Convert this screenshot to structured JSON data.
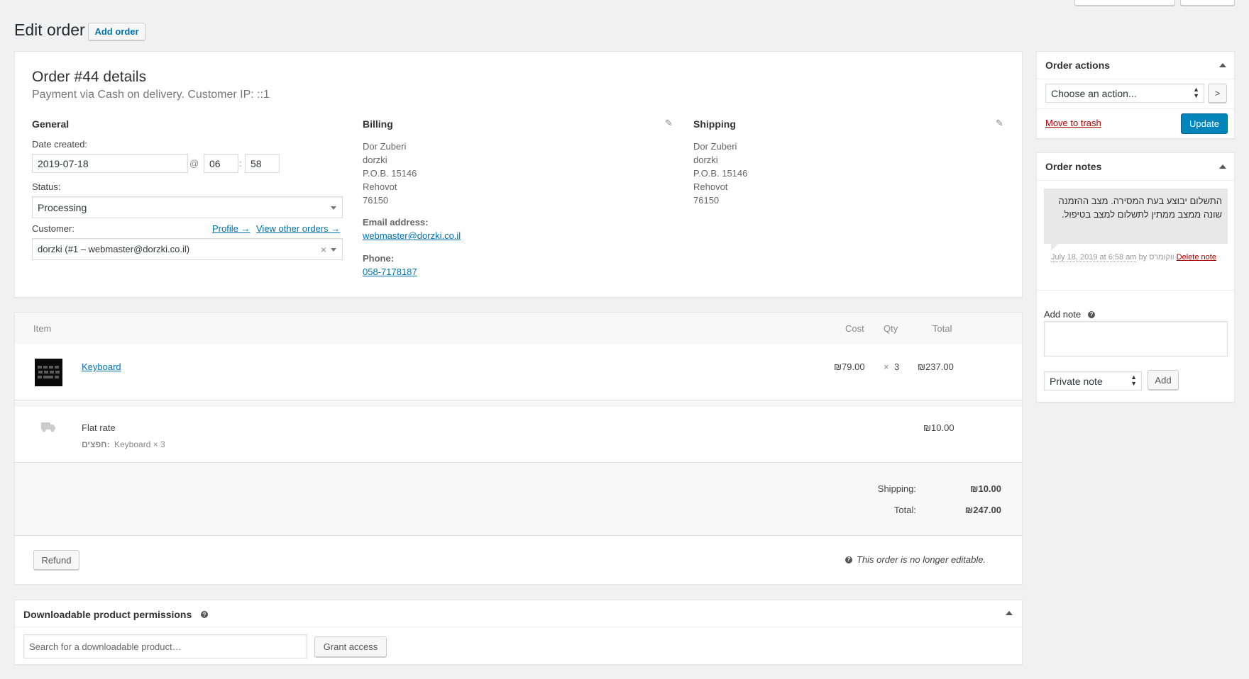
{
  "header": {
    "title": "Edit order",
    "add_order_label": "Add order"
  },
  "order": {
    "heading": "Order #44 details",
    "meta": "Payment via Cash on delivery. Customer IP: ::1",
    "general": {
      "title": "General",
      "date_label": "Date created:",
      "date_value": "2019-07-18",
      "at_sep": "@",
      "hour": "06",
      "colon": ":",
      "minute": "58",
      "status_label": "Status:",
      "status_value": "Processing",
      "customer_label": "Customer:",
      "profile_link": "Profile →",
      "other_orders_link": "View other orders →",
      "customer_value": "dorzki (#1 – webmaster@dorzki.co.il)",
      "clear_glyph": "×"
    },
    "billing": {
      "title": "Billing",
      "address": [
        "Dor Zuberi",
        "dorzki",
        "P.O.B. 15146",
        "Rehovot",
        "76150"
      ],
      "email_label": "Email address:",
      "email": "webmaster@dorzki.co.il",
      "phone_label": "Phone:",
      "phone": "058-7178187"
    },
    "shipping": {
      "title": "Shipping",
      "address": [
        "Dor Zuberi",
        "dorzki",
        "P.O.B. 15146",
        "Rehovot",
        "76150"
      ]
    }
  },
  "items": {
    "headers": {
      "item": "Item",
      "cost": "Cost",
      "qty": "Qty",
      "total": "Total"
    },
    "rows": [
      {
        "name": "Keyboard",
        "cost": "₪79.00",
        "qty_x": "×",
        "qty": "3",
        "total": "₪237.00"
      }
    ],
    "shipping_line": {
      "name": "Flat rate",
      "meta_key": "חפצים:",
      "meta_value": "Keyboard × 3",
      "total": "₪10.00"
    },
    "totals": [
      {
        "label": "Shipping:",
        "value": "₪10.00"
      },
      {
        "label": "Total:",
        "value": "₪247.00"
      }
    ],
    "refund_label": "Refund",
    "not_editable": "This order is no longer editable."
  },
  "downloads": {
    "title": "Downloadable product permissions",
    "search_placeholder": "Search for a downloadable product…",
    "grant_label": "Grant access"
  },
  "order_actions": {
    "title": "Order actions",
    "select_value": "Choose an action...",
    "go_glyph": ">",
    "trash_label": "Move to trash",
    "update_label": "Update"
  },
  "order_notes": {
    "title": "Order notes",
    "note_text": "התשלום יבוצע בעת המסירה. מצב ההזמנה שונה ממצב ממתין לתשלום למצב בטיפול.",
    "note_date": "July 18, 2019 at 6:58 am",
    "note_by": "by ווקומרס",
    "delete_label": "Delete note",
    "add_note_label": "Add note",
    "note_type_value": "Private note",
    "add_button": "Add"
  },
  "colors": {
    "primary": "#0085ba",
    "link": "#0073aa",
    "danger": "#a00"
  }
}
